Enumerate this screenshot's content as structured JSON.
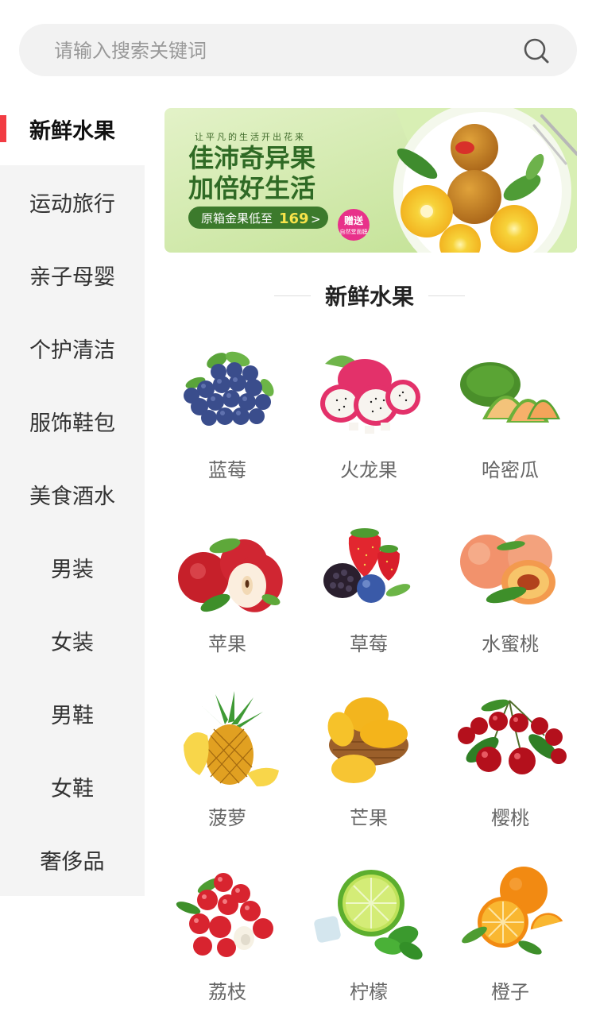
{
  "search": {
    "placeholder": "请输入搜索关键词"
  },
  "sidebar": {
    "items": [
      {
        "label": "新鲜水果",
        "active": true
      },
      {
        "label": "运动旅行"
      },
      {
        "label": "亲子母婴"
      },
      {
        "label": "个护清洁"
      },
      {
        "label": "服饰鞋包"
      },
      {
        "label": "美食酒水"
      },
      {
        "label": "男装"
      },
      {
        "label": "女装"
      },
      {
        "label": "男鞋"
      },
      {
        "label": "女鞋"
      },
      {
        "label": "奢侈品"
      }
    ]
  },
  "banner": {
    "tagline": "让平凡的生活开出花来",
    "headline1": "佳沛奇异果",
    "headline2": "加倍好生活",
    "price_pre": "原箱金果低至",
    "price": "169",
    "arrow": ">",
    "gift": "赠送",
    "gift_sub": "自然堂面膜"
  },
  "section": {
    "title": "新鲜水果"
  },
  "products": [
    {
      "name": "蓝莓",
      "icon": "blueberry-icon"
    },
    {
      "name": "火龙果",
      "icon": "dragonfruit-icon"
    },
    {
      "name": "哈密瓜",
      "icon": "melon-icon"
    },
    {
      "name": "苹果",
      "icon": "apple-icon"
    },
    {
      "name": "草莓",
      "icon": "strawberry-icon"
    },
    {
      "name": "水蜜桃",
      "icon": "peach-icon"
    },
    {
      "name": "菠萝",
      "icon": "pineapple-icon"
    },
    {
      "name": "芒果",
      "icon": "mango-icon"
    },
    {
      "name": "樱桃",
      "icon": "cherry-icon"
    },
    {
      "name": "荔枝",
      "icon": "lychee-icon"
    },
    {
      "name": "柠檬",
      "icon": "lime-icon"
    },
    {
      "name": "橙子",
      "icon": "orange-icon"
    }
  ],
  "colors": {
    "accent": "#f23c43",
    "sidebar_bg": "#f4f4f4",
    "banner_bg": "#cfe8a6"
  }
}
